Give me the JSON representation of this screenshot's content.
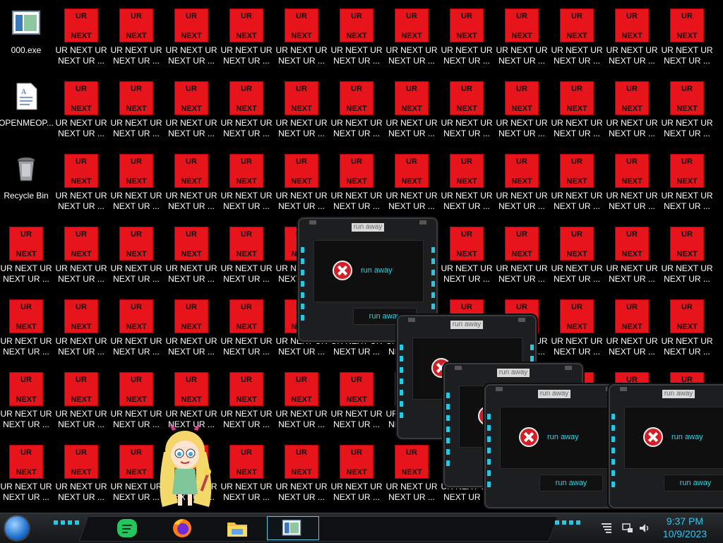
{
  "desktop": {
    "system_icons": [
      {
        "name": "000.exe",
        "icon": "window-app-icon"
      },
      {
        "name": "OPENMEOP...",
        "icon": "document-icon"
      },
      {
        "name": "Recycle Bin",
        "icon": "recycle-bin-icon"
      }
    ],
    "ur_icon": {
      "top_text": "UR",
      "bottom_text": "NEXT",
      "label_line1": "UR NEXT UR",
      "label_line2": "NEXT UR ..."
    }
  },
  "dialogs": [
    {
      "caption": "run away",
      "message": "run away",
      "button": "run away"
    },
    {
      "caption": "run away",
      "message": "run away",
      "button": "run away"
    },
    {
      "caption": "run away",
      "message": "run away",
      "button": "run away"
    },
    {
      "caption": "run away",
      "message": "run away",
      "button": "run away"
    },
    {
      "caption": "run away",
      "message": "run away",
      "button": "run away"
    }
  ],
  "taskbar": {
    "apps": [
      "notes-app-icon",
      "firefox-icon",
      "file-explorer-icon",
      "active-window-icon"
    ],
    "time": "9:37 PM",
    "date": "10/9/2023",
    "tray": [
      "network-icon",
      "volume-icon",
      "action-center-icon"
    ],
    "accent": "#36c6f0"
  }
}
